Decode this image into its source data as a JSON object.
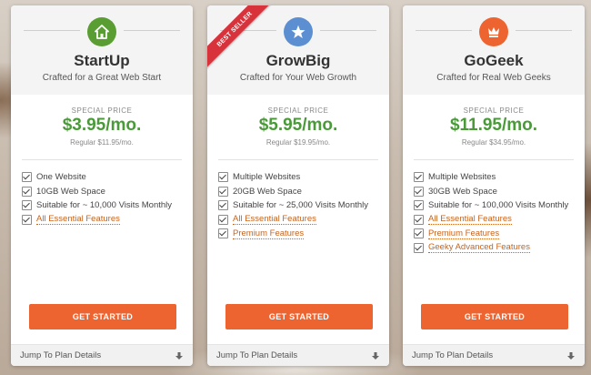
{
  "plans": [
    {
      "name": "StartUp",
      "subtitle": "Crafted for a Great Web Start",
      "icon": "house-icon",
      "icon_color": "#5a9e33",
      "special_label": "SPECIAL PRICE",
      "price": "$3.95/mo.",
      "regular": "Regular $11.95/mo.",
      "features": [
        {
          "text": "One Website",
          "link": false
        },
        {
          "text": "10GB Web Space",
          "link": false
        },
        {
          "text": "Suitable for ~ 10,000 Visits Monthly",
          "link": false
        },
        {
          "text": "All Essential Features",
          "link": true
        }
      ],
      "button": "GET STARTED",
      "details": "Jump To Plan Details"
    },
    {
      "name": "GrowBig",
      "subtitle": "Crafted for Your Web Growth",
      "icon": "star-icon",
      "icon_color": "#5b8fd1",
      "ribbon": "BEST SELLER",
      "special_label": "SPECIAL PRICE",
      "price": "$5.95/mo.",
      "regular": "Regular $19.95/mo.",
      "features": [
        {
          "text": "Multiple Websites",
          "link": false
        },
        {
          "text": "20GB Web Space",
          "link": false
        },
        {
          "text": "Suitable for ~ 25,000 Visits Monthly",
          "link": false
        },
        {
          "text": "All Essential Features",
          "link": true
        },
        {
          "text": "Premium Features",
          "link": true
        }
      ],
      "button": "GET STARTED",
      "details": "Jump To Plan Details"
    },
    {
      "name": "GoGeek",
      "subtitle": "Crafted for Real Web Geeks",
      "icon": "crown-icon",
      "icon_color": "#ee6430",
      "special_label": "SPECIAL PRICE",
      "price": "$11.95/mo.",
      "regular": "Regular $34.95/mo.",
      "features": [
        {
          "text": "Multiple Websites",
          "link": false
        },
        {
          "text": "30GB Web Space",
          "link": false
        },
        {
          "text": "Suitable for ~ 100,000 Visits Monthly",
          "link": false
        },
        {
          "text": "All Essential Features",
          "link": true
        },
        {
          "text": "Premium Features",
          "link": true
        },
        {
          "text": "Geeky Advanced Features",
          "link": true
        }
      ],
      "button": "GET STARTED",
      "details": "Jump To Plan Details"
    }
  ],
  "colors": {
    "price_green": "#4a9a3a",
    "button_orange": "#ee6430",
    "ribbon_red": "#d8333b",
    "link_orange": "#c8641e"
  }
}
